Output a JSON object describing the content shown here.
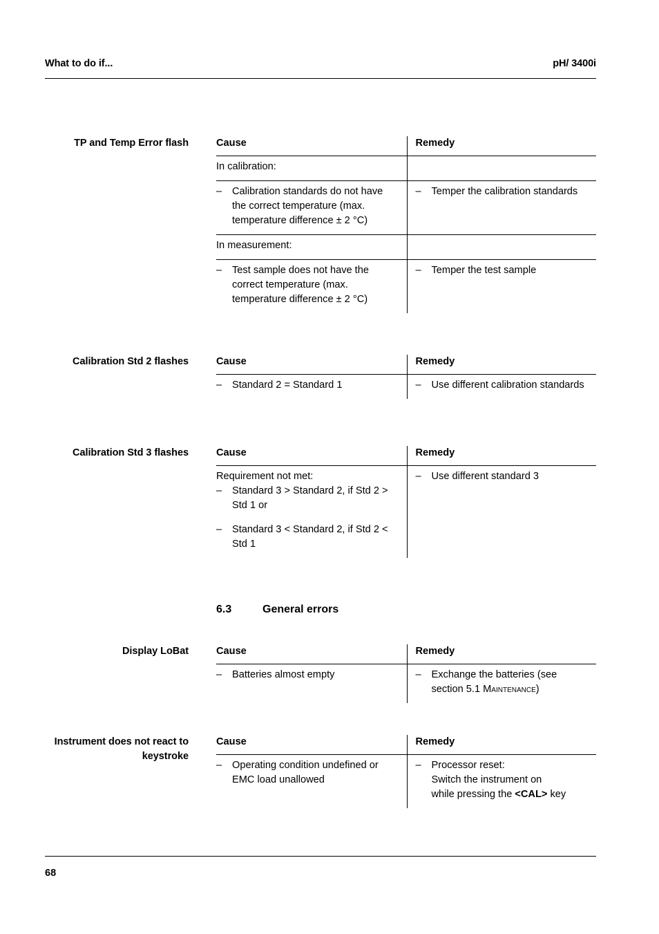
{
  "header": {
    "left": "What to do if...",
    "right": "pH/ 3400i"
  },
  "footer": {
    "page_number": "68"
  },
  "table_headers": {
    "cause": "Cause",
    "remedy": "Remedy"
  },
  "blocks": [
    {
      "label": "TP and Temp Error flash",
      "rows": [
        {
          "cause_intro": "In calibration:",
          "remedy_empty": ""
        },
        {
          "cause_item": "Calibration standards do not have the correct temperature (max. temperature difference ± 2 °C)",
          "remedy_item": "Temper the calibration standards"
        },
        {
          "cause_intro": "In measurement:",
          "remedy_empty": ""
        },
        {
          "cause_item": "Test sample does not have the correct temperature (max. temperature difference ± 2 °C)",
          "remedy_item": "Temper the test sample"
        }
      ]
    },
    {
      "label": "Calibration Std 2 flashes",
      "rows": [
        {
          "cause_item": "Standard 2 = Standard 1",
          "remedy_item": "Use different calibration standards"
        }
      ]
    },
    {
      "label": "Calibration Std 3 flashes",
      "rows": [
        {
          "cause_intro": "Requirement not met:",
          "cause_item_1": "Standard 3 > Standard 2, if Std 2 > Std 1 or",
          "cause_item_2": "Standard 3 < Standard 2, if Std 2 < Std 1",
          "remedy_item": "Use different standard 3"
        }
      ]
    }
  ],
  "section": {
    "number": "6.3",
    "title": "General errors"
  },
  "general_blocks": [
    {
      "label": "Display LoBat",
      "cause_item": "Batteries almost empty",
      "remedy_item_pre": "Exchange the batteries (see section 5.1 ",
      "remedy_item_smallcaps": "Maintenance",
      "remedy_item_post": ")"
    },
    {
      "label": "Instrument does not react to keystroke",
      "cause_item": "Operating condition undefined or EMC load unallowed",
      "remedy_line_1": "Processor reset:",
      "remedy_line_2": "Switch the instrument on",
      "remedy_line_3_pre": "while pressing the ",
      "remedy_line_3_key": "<CAL>",
      "remedy_line_3_post": " key"
    }
  ],
  "icons": {
    "bullet_dash": "–"
  }
}
